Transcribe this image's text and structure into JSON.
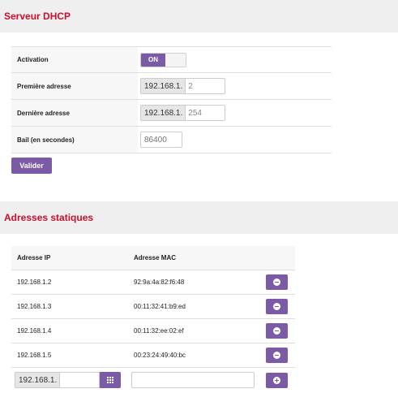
{
  "dhcp": {
    "title": "Serveur DHCP",
    "rows": {
      "activation_label": "Activation",
      "activation_toggle": "ON",
      "first_label": "Première adresse",
      "first_prefix": "192.168.1.",
      "first_value": "2",
      "last_label": "Dernière adresse",
      "last_prefix": "192.168.1.",
      "last_value": "254",
      "lease_label": "Bail (en secondes)",
      "lease_placeholder": "86400"
    },
    "submit_label": "Valider"
  },
  "static": {
    "title": "Adresses statiques",
    "headers": {
      "ip": "Adresse IP",
      "mac": "Adresse MAC"
    },
    "rows": [
      {
        "ip": "192.168.1.2",
        "mac": "92:9a:4a:82:f6:48"
      },
      {
        "ip": "192.168.1.3",
        "mac": "00:11:32:41:b9:ed"
      },
      {
        "ip": "192.168.1.4",
        "mac": "00:11:32:ee:02:ef"
      },
      {
        "ip": "192.168.1.5",
        "mac": "00:23:24:49:40:bc"
      }
    ],
    "new_entry": {
      "ip_prefix": "192.168.1.",
      "ip_value": "",
      "mac_value": ""
    }
  },
  "colors": {
    "accent": "#7b5aa6",
    "title": "#c8102e",
    "band": "#efefef"
  },
  "icons": {
    "remove": "minus-circle-icon",
    "add": "plus-circle-icon",
    "picker": "grid-icon"
  }
}
